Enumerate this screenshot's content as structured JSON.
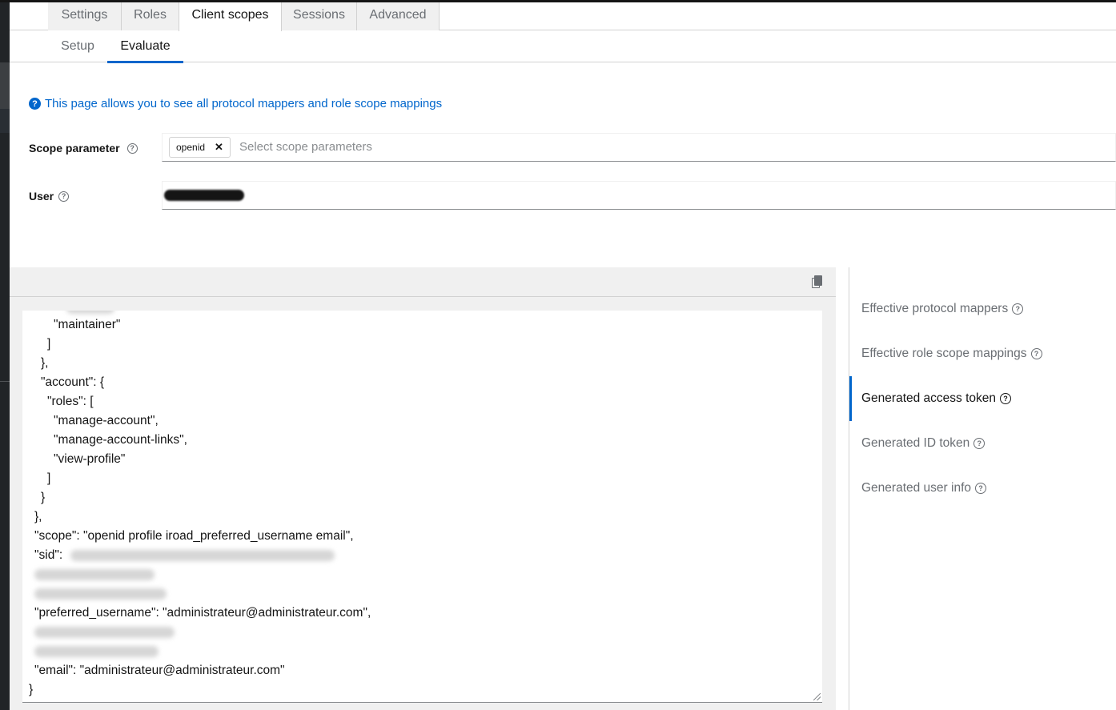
{
  "tabs": [
    {
      "label": "Settings"
    },
    {
      "label": "Roles"
    },
    {
      "label": "Client scopes"
    },
    {
      "label": "Sessions"
    },
    {
      "label": "Advanced"
    }
  ],
  "subtabs": [
    {
      "label": "Setup"
    },
    {
      "label": "Evaluate"
    }
  ],
  "info_text": "This page allows you to see all protocol mappers and role scope mappings",
  "scope_parameter": {
    "label": "Scope parameter",
    "chip": "openid",
    "placeholder": "Select scope parameters"
  },
  "user": {
    "label": "User"
  },
  "code_lines": [
    "\"maintainer\"",
    "]",
    "},",
    "\"account\": {",
    "\"roles\": [",
    "\"manage-account\",",
    "\"manage-account-links\",",
    "\"view-profile\"",
    "]",
    "}",
    "},",
    "\"scope\": \"openid profile iroad_preferred_username email\",",
    "\"sid\":",
    "\"preferred_username\": \"administrateur@administrateur.com\",",
    "\"email\": \"administrateur@administrateur.com\"",
    "}"
  ],
  "nav": [
    {
      "label": "Effective protocol mappers"
    },
    {
      "label": "Effective role scope mappings"
    },
    {
      "label": "Generated access token"
    },
    {
      "label": "Generated ID token"
    },
    {
      "label": "Generated user info"
    }
  ]
}
